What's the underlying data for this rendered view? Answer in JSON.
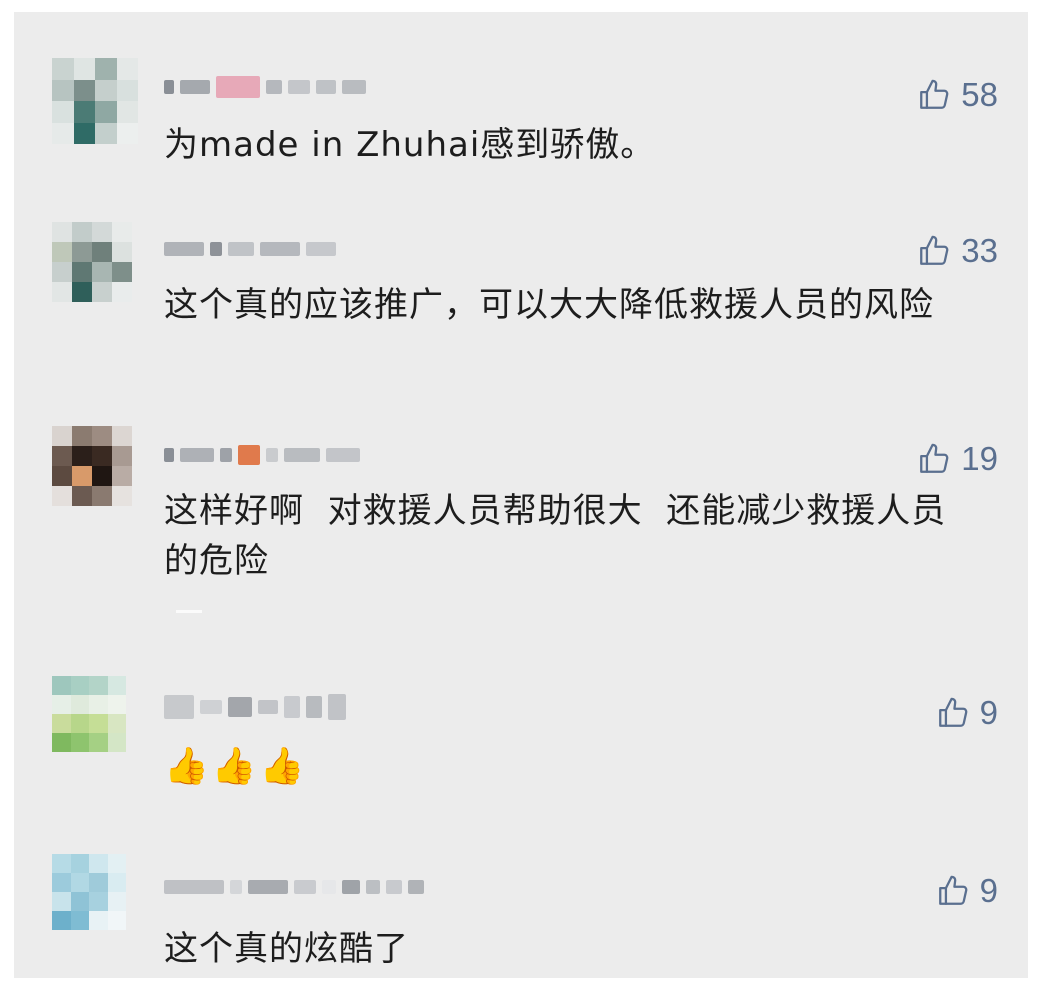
{
  "comments": [
    {
      "likes": "58",
      "text": "为made in Zhuhai感到骄傲。"
    },
    {
      "likes": "33",
      "text": "这个真的应该推广，可以大大降低救援人员的风险"
    },
    {
      "likes": "19",
      "text": "这样好啊  对救援人员帮助很大  还能减少救援人员的危险"
    },
    {
      "likes": "9",
      "emojis": [
        "👍",
        "👍",
        "👍"
      ]
    },
    {
      "likes": "9",
      "text": "这个真的炫酷了"
    }
  ],
  "icons": {
    "like": "thumbs-up-outline-icon",
    "avatar": "pixelated-avatar"
  },
  "colors": {
    "background": "#ececec",
    "text": "#1d1d1d",
    "like": "#5a6f8f"
  }
}
